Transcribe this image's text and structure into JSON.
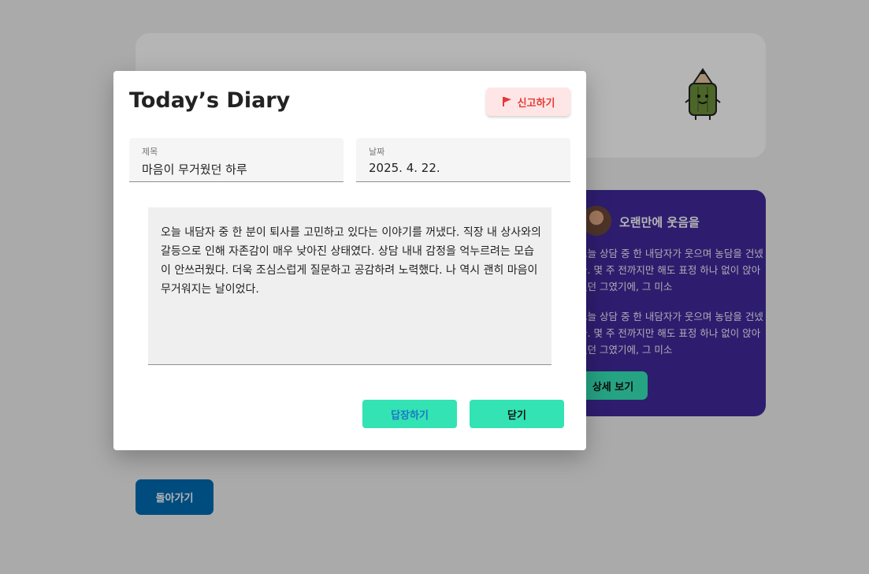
{
  "modal": {
    "title": "Today’s Diary",
    "report_label": "신고하기",
    "report_icon": "flag-icon",
    "fields": {
      "title_label": "제목",
      "title_value": "마음이 무거웠던 하루",
      "date_label": "날짜",
      "date_value": "2025. 4. 22."
    },
    "content": "오늘 내담자 중 한 분이 퇴사를 고민하고 있다는 이야기를 꺼냈다. 직장 내 상사와의 갈등으로 인해 자존감이 매우 낮아진 상태였다. 상담 내내 감정을 억누르려는 모습이 안쓰러웠다. 더욱 조심스럽게 질문하고 공감하려 노력했다. 나 역시 괜히 마음이 무거워지는 날이었다.",
    "reply_label": "답장하기",
    "close_label": "닫기"
  },
  "background": {
    "mascot_icon": "pencil-mascot-icon",
    "card": {
      "title": "오랜만에 웃음을",
      "text_1": "오늘 상담 중 한 내담자가 웃으며 농담을 건넸다. 몇 주 전까지만 해도 표정 하나 없이 앉아있던 그였기에, 그 미소",
      "text_2": "오늘 상담 중 한 내담자가 웃으며 농담을 건넸다. 몇 주 전까지만 해도 표정 하나 없이 앉아있던 그였기에, 그 미소",
      "detail_label": "상세 보기"
    },
    "back_label": "돌아가기"
  },
  "colors": {
    "accent_mint": "#33e3b3",
    "card_purple": "#412a9c",
    "back_blue": "#006bb4",
    "report_red": "#e53935"
  }
}
